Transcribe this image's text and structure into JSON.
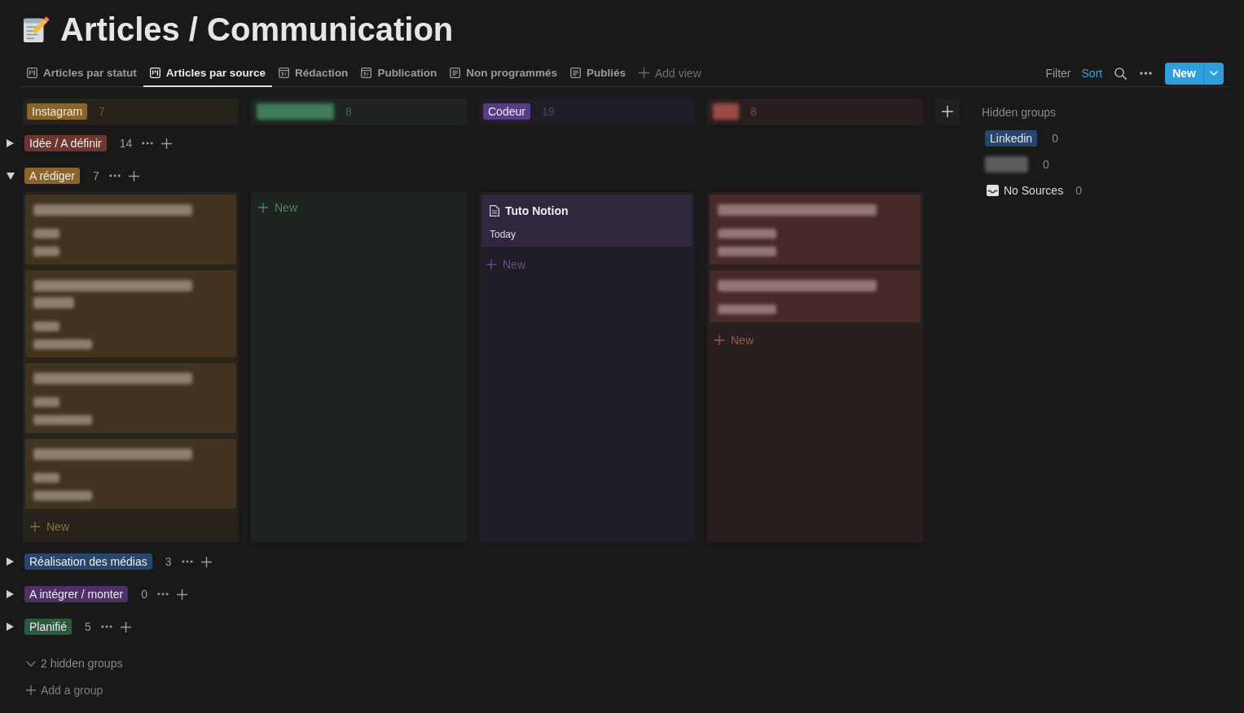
{
  "page": {
    "title": "Articles / Communication"
  },
  "views": [
    {
      "kind": "board",
      "label": "Articles par statut",
      "selected": false
    },
    {
      "kind": "board",
      "label": "Articles par source",
      "selected": true
    },
    {
      "kind": "calendar",
      "label": "Rédaction",
      "selected": false
    },
    {
      "kind": "calendar",
      "label": "Publication",
      "selected": false
    },
    {
      "kind": "list",
      "label": "Non programmés",
      "selected": false
    },
    {
      "kind": "list",
      "label": "Publiés",
      "selected": false
    }
  ],
  "add_view": "Add view",
  "toolbar": {
    "filter": {
      "label": "Filter",
      "active": false
    },
    "sort": {
      "label": "Sort",
      "active": true
    },
    "new_button": "New"
  },
  "board": {
    "columns": [
      {
        "kind": "tag",
        "label": "Instagram",
        "count": "7",
        "color": "#8b6428"
      },
      {
        "kind": "blurred-wide",
        "count": "8",
        "color": "#3f7d58"
      },
      {
        "kind": "tag",
        "label": "Codeur",
        "count": "19",
        "color": "#5a3d88"
      },
      {
        "kind": "blurred-narrow",
        "count": "8",
        "color": "#9c4a45"
      }
    ],
    "groups": [
      {
        "label": "Idée / A définir",
        "count": "14",
        "color": "#6e3630",
        "expanded": false
      },
      {
        "label": "A rédiger",
        "count": "7",
        "color": "#8b6428",
        "expanded": true,
        "cells": [
          {
            "cards": [
              {
                "kind": "blurred",
                "rows": [
                  {
                    "kind": "title"
                  },
                  {
                    "kind": "detail-short"
                  },
                  {
                    "kind": "detail-short"
                  }
                ]
              },
              {
                "kind": "blurred",
                "rows": [
                  {
                    "kind": "title"
                  },
                  {
                    "kind": "title-cont"
                  },
                  {
                    "kind": "detail-short"
                  },
                  {
                    "kind": "detail-long"
                  }
                ]
              },
              {
                "kind": "blurred",
                "rows": [
                  {
                    "kind": "title"
                  },
                  {
                    "kind": "detail-short"
                  },
                  {
                    "kind": "detail-long"
                  }
                ]
              },
              {
                "kind": "blurred",
                "rows": [
                  {
                    "kind": "title"
                  },
                  {
                    "kind": "detail-short"
                  },
                  {
                    "kind": "detail-long"
                  }
                ]
              }
            ],
            "new_label": "New"
          },
          {
            "new_label": "New"
          },
          {
            "cards": [
              {
                "kind": "page",
                "title": "Tuto Notion",
                "lines": [
                  "Today"
                ]
              }
            ],
            "new_label": "New"
          },
          {
            "cards": [
              {
                "kind": "blurred",
                "rows": [
                  {
                    "kind": "title"
                  },
                  {
                    "kind": "detail-long"
                  },
                  {
                    "kind": "detail-long"
                  }
                ]
              },
              {
                "kind": "blurred",
                "rows": [
                  {
                    "kind": "title"
                  },
                  {
                    "kind": "detail-long"
                  }
                ]
              }
            ],
            "new_label": "New"
          }
        ]
      },
      {
        "label": "Réalisation des médias",
        "count": "3",
        "color": "#28456c",
        "expanded": false
      },
      {
        "label": "A intégrer / monter",
        "count": "0",
        "color": "#4d3168",
        "expanded": false
      },
      {
        "label": "Planifié",
        "count": "5",
        "color": "#2b5a3e",
        "expanded": false
      }
    ]
  },
  "hidden_groups": {
    "title": "Hidden groups",
    "items": [
      {
        "kind": "tag",
        "label": "Linkedin",
        "count": "0",
        "color": "#28456c"
      },
      {
        "kind": "blurred",
        "count": "0",
        "color": "#5c5c5c"
      },
      {
        "kind": "no-value",
        "label": "No Sources",
        "count": "0"
      }
    ]
  },
  "footer": {
    "hidden_toggle": "2 hidden groups",
    "add_group": "Add a group"
  }
}
